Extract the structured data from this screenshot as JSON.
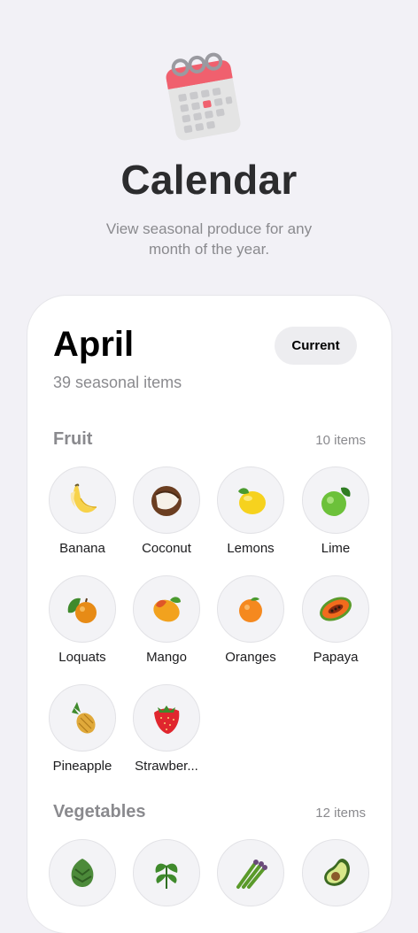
{
  "header": {
    "title": "Calendar",
    "subtitle": "View seasonal produce for any month of the year.",
    "icon": "calendar-icon"
  },
  "month_card": {
    "month": "April",
    "count_text": "39 seasonal items",
    "current_button": "Current"
  },
  "sections": [
    {
      "title": "Fruit",
      "count_text": "10 items",
      "items": [
        {
          "label": "Banana",
          "icon": "banana-icon"
        },
        {
          "label": "Coconut",
          "icon": "coconut-icon"
        },
        {
          "label": "Lemons",
          "icon": "lemon-icon"
        },
        {
          "label": "Lime",
          "icon": "lime-icon"
        },
        {
          "label": "Loquats",
          "icon": "loquat-icon"
        },
        {
          "label": "Mango",
          "icon": "mango-icon"
        },
        {
          "label": "Oranges",
          "icon": "orange-icon"
        },
        {
          "label": "Papaya",
          "icon": "papaya-icon"
        },
        {
          "label": "Pineapple",
          "icon": "pineapple-icon"
        },
        {
          "label": "Strawber...",
          "icon": "strawberry-icon"
        }
      ]
    },
    {
      "title": "Vegetables",
      "count_text": "12 items",
      "items": [
        {
          "label": "",
          "icon": "artichoke-icon"
        },
        {
          "label": "",
          "icon": "arugula-icon"
        },
        {
          "label": "",
          "icon": "asparagus-icon"
        },
        {
          "label": "",
          "icon": "avocado-icon"
        }
      ]
    }
  ],
  "colors": {
    "background": "#f2f1f6",
    "card": "#ffffff",
    "secondary_text": "#8a8a8e",
    "calendar_accent": "#f0606e"
  }
}
